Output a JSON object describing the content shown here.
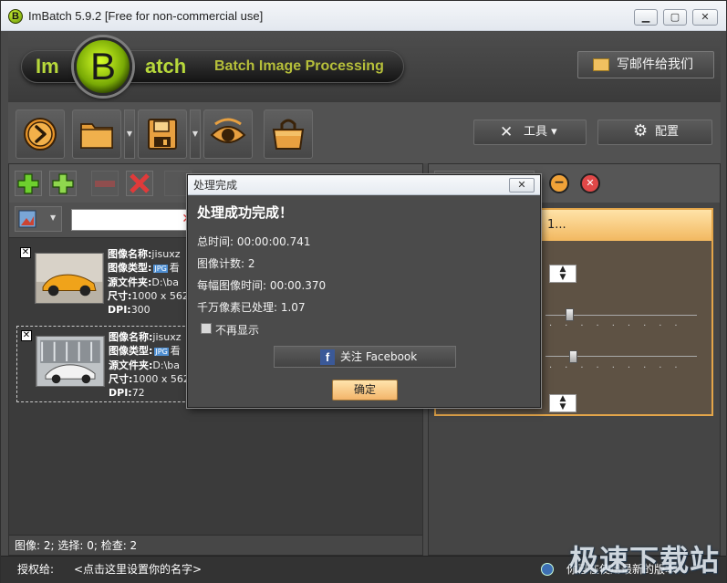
{
  "window": {
    "title": "ImBatch 5.9.2 [Free for non-commercial use]",
    "app_icon_letter": "B",
    "controls": {
      "minimize": "▭",
      "maximize": "▢",
      "close": "✕"
    }
  },
  "banner": {
    "logo_prefix": "Im",
    "logo_letter": "B",
    "logo_suffix": "atch",
    "tagline": "Batch Image Processing",
    "mail_button": "写邮件给我们"
  },
  "toolbar": {
    "tools_label": "工具 ▾",
    "config_label": "配置",
    "icons": [
      "run-icon",
      "open-folder-icon",
      "save-icon",
      "preview-eye-icon",
      "basket-icon"
    ]
  },
  "images": {
    "items": [
      {
        "name_label": "图像名称:",
        "name": "jisuxz",
        "type_label": "图像类型:",
        "type": "看",
        "folder_label": "源文件夹:",
        "folder": "D:\\ba",
        "size_label": "尺寸:",
        "size": "1000 x 562",
        "dpi_label": "DPI:",
        "dpi": "300",
        "checked": "✕"
      },
      {
        "name_label": "图像名称:",
        "name": "jisuxz",
        "type_label": "图像类型:",
        "type": "看",
        "folder_label": "源文件夹:",
        "folder": "D:\\ba",
        "size_label": "尺寸:",
        "size": "1000 x 562",
        "dpi_label": "DPI:",
        "dpi": "72",
        "checked": "✕"
      }
    ],
    "status": "图像: 2; 选择: 0; 检查: 2"
  },
  "right_panel": {
    "header": "1..."
  },
  "statusbar": {
    "license_label": "授权给:",
    "license_value": "<点击这里设置你的名字>",
    "version_text": "你已在使用最新的版本"
  },
  "dialog": {
    "title": "处理完成",
    "close": "✕",
    "heading": "处理成功完成！",
    "total_time": "总时间: 00:00:00.741",
    "image_count": "图像计数: 2",
    "per_image_time": "每幅图像时间: 00:00.370",
    "megapixels": "千万像素已处理: 1.07",
    "dont_show": "不再显示",
    "facebook": "关注 Facebook",
    "facebook_icon_letter": "f",
    "ok": "确定"
  },
  "watermark": "极速下载站",
  "colors": {
    "accent": "#b7d83b",
    "highlight": "#f2b860",
    "background": "#4a4a4a"
  }
}
